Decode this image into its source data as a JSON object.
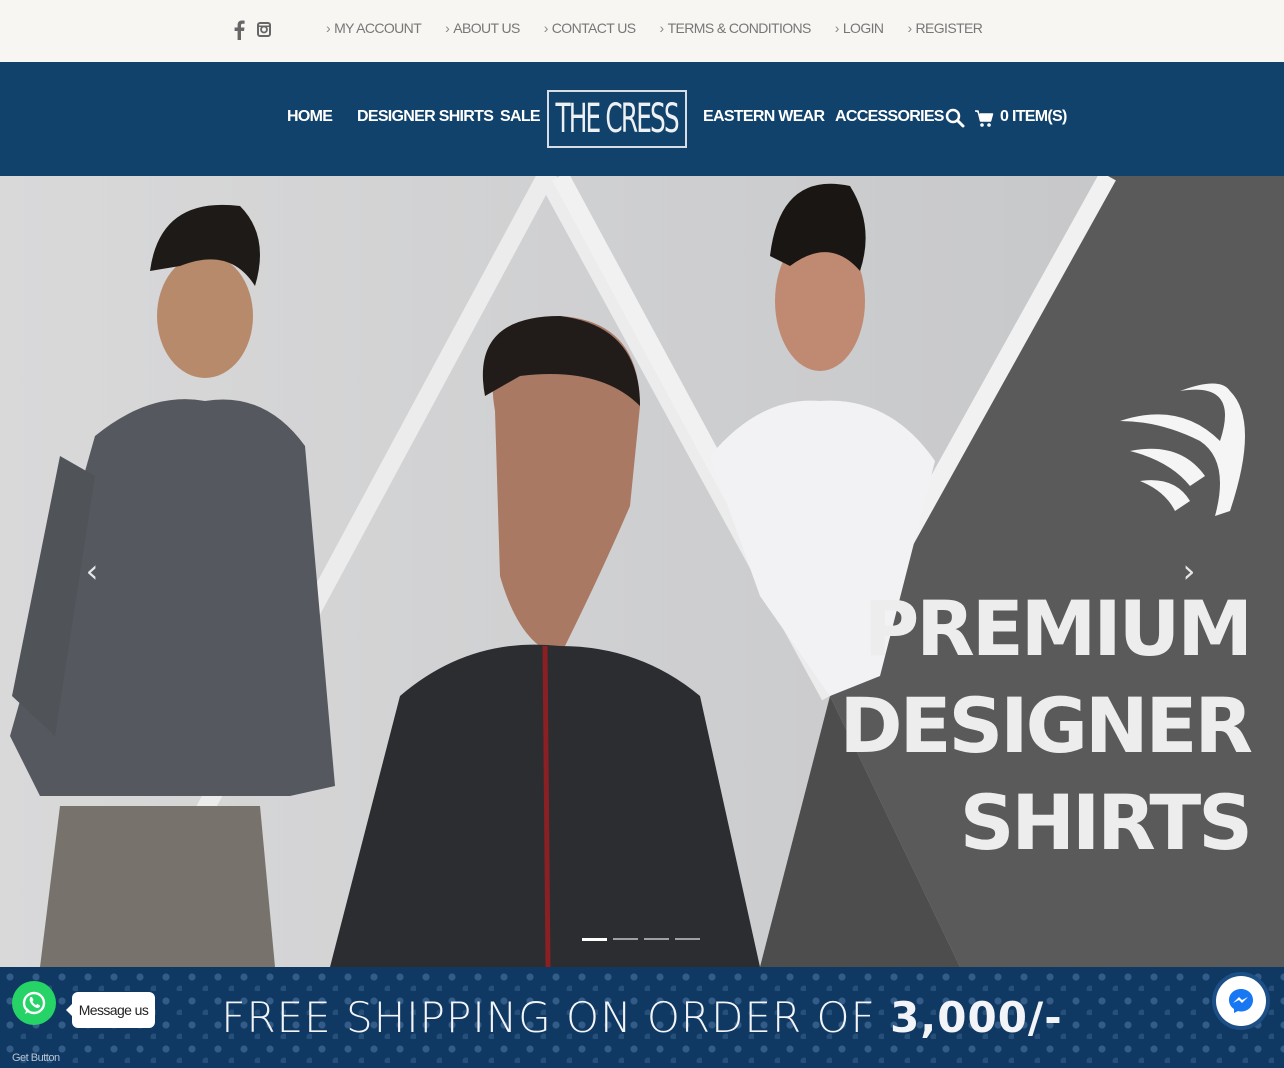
{
  "topbar": {
    "social": [
      {
        "icon": "facebook-icon"
      },
      {
        "icon": "instagram-icon"
      }
    ],
    "links": [
      {
        "label": "MY ACCOUNT"
      },
      {
        "label": "ABOUT US"
      },
      {
        "label": "CONTACT US"
      },
      {
        "label": "TERMS & CONDITIONS"
      },
      {
        "label": "LOGIN"
      },
      {
        "label": "REGISTER"
      }
    ]
  },
  "nav": {
    "items": [
      {
        "label": "HOME"
      },
      {
        "label": "DESIGNER SHIRTS"
      },
      {
        "label": "SALE"
      },
      {
        "label": "EASTERN WEAR"
      },
      {
        "label": "ACCESSORIES"
      }
    ],
    "logo_text": "THE CRESS",
    "search_icon": "search-icon",
    "cart_icon": "cart-icon",
    "cart_label": "0 ITEM(S)"
  },
  "hero": {
    "headline": [
      "PREMIUM",
      "DESIGNER",
      "SHIRTS"
    ],
    "prev_icon": "chevron-left-icon",
    "next_icon": "chevron-right-icon",
    "slides_count": 4,
    "active_slide": 1
  },
  "banner": {
    "text": "FREE SHIPPING ON ORDER OF ",
    "amount": "3,000/-"
  },
  "widgets": {
    "whatsapp_icon": "whatsapp-icon",
    "message_label": "Message us",
    "get_button_label": "Get Button",
    "messenger_icon": "messenger-icon"
  },
  "colors": {
    "topbar_bg": "#f8f6f3",
    "nav_bg": "#10426b",
    "banner_bg": "#0f3863",
    "whatsapp_green": "#25d366"
  }
}
